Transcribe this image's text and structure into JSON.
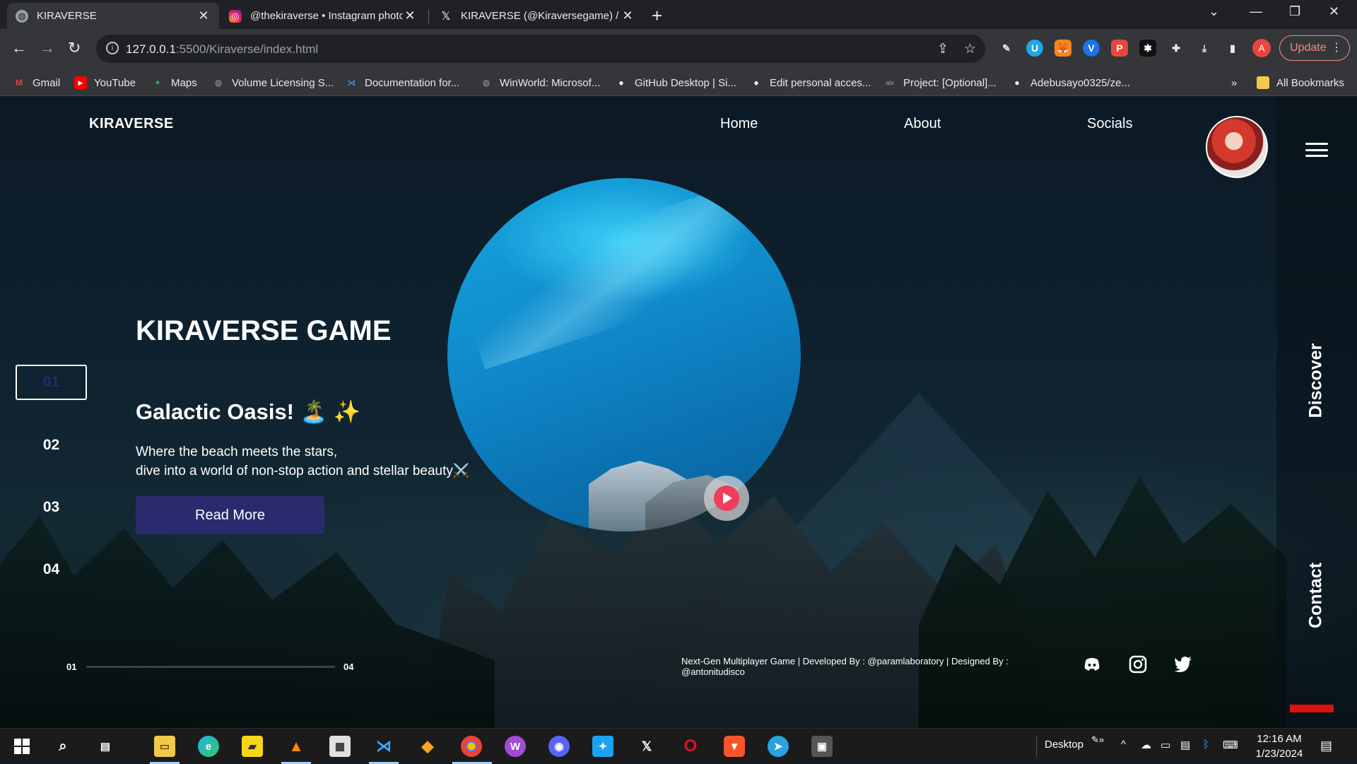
{
  "browser": {
    "tabs": [
      {
        "title": "KIRAVERSE",
        "active": true,
        "icon": "globe-icon"
      },
      {
        "title": "@thekiraverse • Instagram photo",
        "active": false,
        "icon": "instagram-icon"
      },
      {
        "title": "KIRAVERSE (@Kiraversegame) / X",
        "active": false,
        "icon": "x-icon"
      }
    ],
    "url_host": "127.0.0.1",
    "url_rest": ":5500/Kiraverse/index.html",
    "update_label": "Update",
    "profile_letter": "A",
    "bookmarks": [
      {
        "label": "Gmail",
        "icon": "gmail-icon"
      },
      {
        "label": "YouTube",
        "icon": "youtube-icon"
      },
      {
        "label": "Maps",
        "icon": "maps-icon"
      },
      {
        "label": "Volume Licensing S...",
        "icon": "globe-icon"
      },
      {
        "label": "Documentation for...",
        "icon": "vscode-icon"
      },
      {
        "label": "WinWorld: Microsof...",
        "icon": "globe-icon"
      },
      {
        "label": "GitHub Desktop | Si...",
        "icon": "github-icon"
      },
      {
        "label": "Edit personal acces...",
        "icon": "github-icon"
      },
      {
        "label": "Project: [Optional]...",
        "icon": "alx-icon"
      },
      {
        "label": "Adebusayo0325/ze...",
        "icon": "github-icon"
      }
    ],
    "bookmarks_overflow": "»",
    "all_bookmarks": "All Bookmarks"
  },
  "site": {
    "logo": "KIRAVERSE",
    "nav": [
      "Home",
      "About",
      "Socials"
    ],
    "hero_title": "KIRAVERSE GAME",
    "subtitle": "Galactic Oasis! 🏝️ ✨",
    "desc_line1": "Where the beach meets the stars,",
    "desc_line2": "dive into a world of non-stop action and stellar beauty⚔️",
    "read_more": "Read More",
    "slides": [
      "01",
      "02",
      "03",
      "04"
    ],
    "active_slide": "01",
    "side_discover": "Discover",
    "side_contact": "Contact",
    "progress_start": "01",
    "progress_end": "04",
    "footer_line1": "Next-Gen Multiplayer Game | Developed By : @paramlaboratory | Designed By :",
    "footer_line2": "@antonitudisco",
    "socials": [
      "discord-icon",
      "instagram-icon",
      "twitter-icon"
    ]
  },
  "taskbar": {
    "desktop_label": "Desktop",
    "time": "12:16 AM",
    "date": "1/23/2024"
  },
  "colors": {
    "accent_button": "#2c2a6e",
    "play_red": "#ef3d5b",
    "orb_blue": "#16a6df",
    "red_bar": "#e01010"
  }
}
